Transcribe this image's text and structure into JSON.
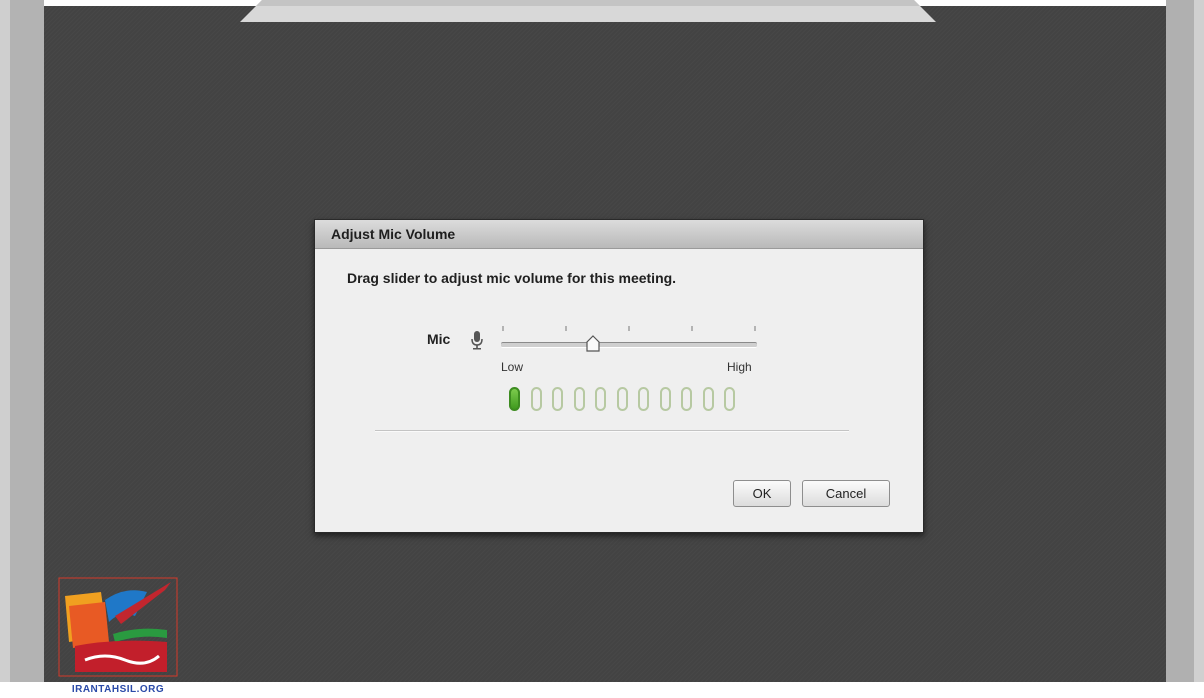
{
  "dialog": {
    "title": "Adjust Mic Volume",
    "instruction": "Drag slider to adjust mic volume for this meeting.",
    "mic_label": "Mic",
    "slider": {
      "low_label": "Low",
      "high_label": "High",
      "level": 0.36
    },
    "meter": {
      "total_bars": 11,
      "active_bars": 1
    },
    "ok_label": "OK",
    "cancel_label": "Cancel"
  },
  "watermark": {
    "text": "IRANTAHSIL.ORG"
  },
  "colors": {
    "stage_background": "#434343",
    "meter_active": "#4fa82a",
    "meter_inactive": "#b7c9a2"
  },
  "icons": [
    "microphone-icon",
    "slider-thumb-icon"
  ]
}
